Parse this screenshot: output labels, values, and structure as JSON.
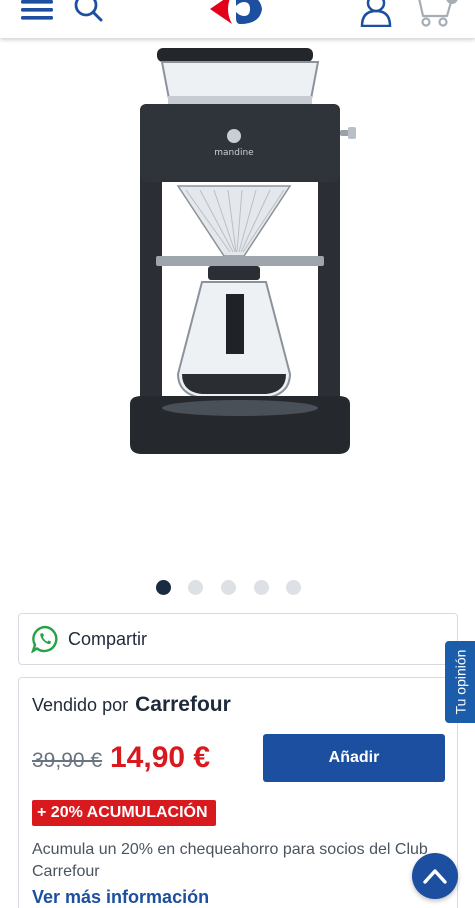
{
  "header": {
    "menu_icon": "hamburger-icon",
    "search_icon": "search-icon",
    "logo": "carrefour-logo",
    "account_icon": "user-icon",
    "cart_icon": "cart-icon"
  },
  "product": {
    "image_brand": "mandine",
    "gallery_total": 5,
    "gallery_active": 1
  },
  "share": {
    "icon": "whatsapp-icon",
    "label": "Compartir"
  },
  "feedback": {
    "label": "Tu opinión"
  },
  "offer": {
    "sold_by_prefix": "Vendido por",
    "seller": "Carrefour",
    "old_price": "39,90 €",
    "new_price": "14,90 €",
    "add_label": "Añadir",
    "promo_badge": "+ 20% ACUMULACIÓN",
    "promo_text": "Acumula un 20% en chequeahorro para socios del Club Carrefour",
    "more_info": "Ver más información"
  },
  "colors": {
    "brand_blue": "#1c4fa0",
    "price_red": "#d81a1e",
    "whatsapp_green": "#25a244"
  },
  "scroll_top_icon": "chevron-up-icon"
}
